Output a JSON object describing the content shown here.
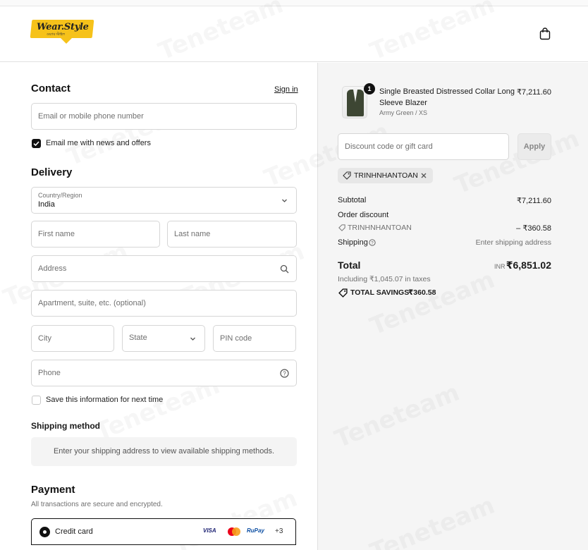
{
  "brand": {
    "name": "Wear.Style",
    "tagline": "ওয়্যার স্টাইল"
  },
  "watermark": "Teneteam",
  "contact": {
    "heading": "Contact",
    "sign_in": "Sign in",
    "email_placeholder": "Email or mobile phone number",
    "news_label": "Email me with news and offers",
    "news_checked": true
  },
  "delivery": {
    "heading": "Delivery",
    "country_label": "Country/Region",
    "country_value": "India",
    "first_name": "First name",
    "last_name": "Last name",
    "address": "Address",
    "apartment": "Apartment, suite, etc. (optional)",
    "city": "City",
    "state": "State",
    "pin": "PIN code",
    "phone": "Phone",
    "save_info": "Save this information for next time",
    "save_checked": false
  },
  "shipping": {
    "heading": "Shipping method",
    "message": "Enter your shipping address to view available shipping methods."
  },
  "payment": {
    "heading": "Payment",
    "note": "All transactions are secure and encrypted.",
    "option": "Credit card",
    "cards": [
      "VISA",
      "RuPay",
      "+3"
    ]
  },
  "summary": {
    "item": {
      "quantity": "1",
      "title_line1": "Single Breasted Distressed Collar Long",
      "title_line2": "Sleeve Blazer",
      "variant": "Army Green / XS",
      "price": "₹7,211.60"
    },
    "discount_placeholder": "Discount code or gift card",
    "apply": "Apply",
    "code": "TRINHNHANTOAN",
    "subtotal_label": "Subtotal",
    "subtotal": "₹7,211.60",
    "order_discount_label": "Order discount",
    "discount_code": "TRINHNHANTOAN",
    "discount_amount": "– ₹360.58",
    "shipping_label": "Shipping",
    "shipping_value": "Enter shipping address",
    "total_label": "Total",
    "currency": "INR",
    "total": "₹6,851.02",
    "taxes": "Including ₹1,045.07 in taxes",
    "savings_label": "TOTAL SAVINGS",
    "savings": "₹360.58"
  }
}
